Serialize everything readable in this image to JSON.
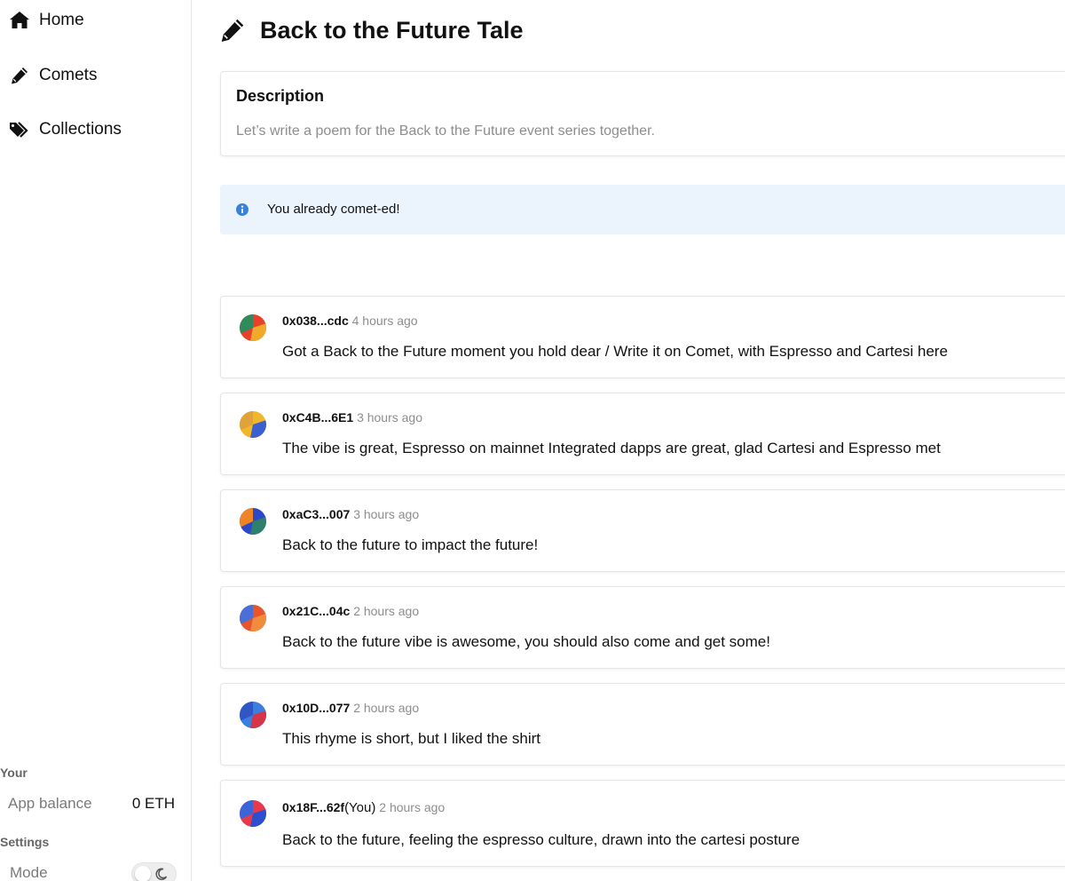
{
  "sidebar": {
    "nav": [
      {
        "label": "Home",
        "icon": "home-icon"
      },
      {
        "label": "Comets",
        "icon": "pencil-icon"
      },
      {
        "label": "Collections",
        "icon": "tags-icon"
      }
    ],
    "your_title": "Your",
    "app_balance_label": "App balance",
    "app_balance_value": "0 ETH",
    "settings_title": "Settings",
    "mode_label": "Mode",
    "mode_icon": "moon-icon"
  },
  "header": {
    "icon": "pencil-icon",
    "title": "Back to the Future Tale"
  },
  "description": {
    "title": "Description",
    "text": "Let’s write a poem for the Back to the Future event series together."
  },
  "alert": {
    "icon": "info-icon",
    "text": "You already comet-ed!"
  },
  "comments": [
    {
      "address": "0x038...cdc",
      "you": "",
      "time": "4 hours ago",
      "text": "Got a Back to the Future moment you hold dear / Write it on Comet, with Espresso and Cartesi here",
      "colors": [
        "#e8412b",
        "#f0a92a",
        "#2f8a5c"
      ]
    },
    {
      "address": "0xC4B...6E1",
      "you": "",
      "time": "3 hours ago",
      "text": "The vibe is great, Espresso on mainnet Integrated dapps are great, glad Cartesi and Espresso met",
      "colors": [
        "#f0b728",
        "#3a5fcf",
        "#e0a33c"
      ]
    },
    {
      "address": "0xaC3...007",
      "you": "",
      "time": "3 hours ago",
      "text": "Back to the future to impact the future!",
      "colors": [
        "#2c48c8",
        "#2e7f6c",
        "#f08424"
      ]
    },
    {
      "address": "0x21C...04c",
      "you": "",
      "time": "2 hours ago",
      "text": "Back to the future vibe is awesome, you should also come and get some!",
      "colors": [
        "#e8542b",
        "#f08c3c",
        "#4a6fd6"
      ]
    },
    {
      "address": "0x10D...077",
      "you": "",
      "time": "2 hours ago",
      "text": "This rhyme is short, but I liked the shirt",
      "colors": [
        "#3b7ee0",
        "#d63448",
        "#2f56c4"
      ]
    },
    {
      "address": "0x18F...62f",
      "you": "(You)",
      "time": "2 hours ago",
      "text": "Back to the future, feeling the espresso culture, drawn into the cartesi posture",
      "colors": [
        "#e8384a",
        "#2c4fd0",
        "#3a64d8"
      ]
    }
  ]
}
